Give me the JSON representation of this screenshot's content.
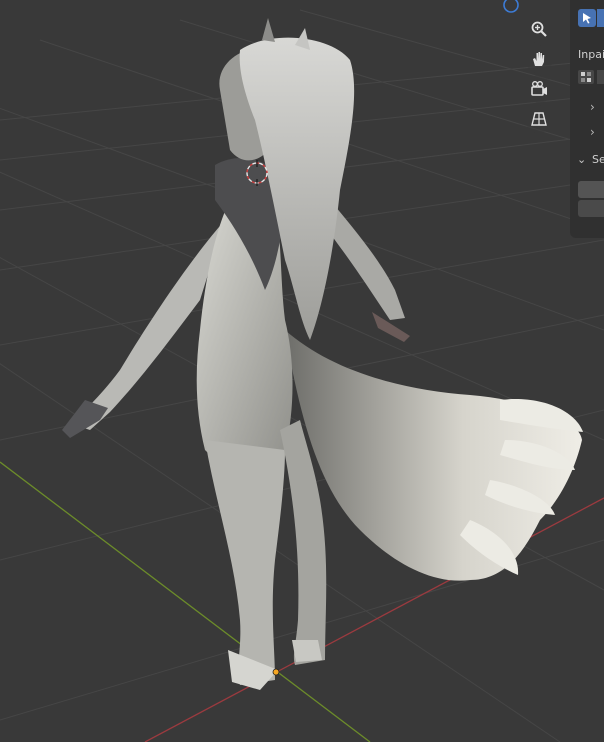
{
  "viewport": {
    "background": "#393939",
    "x_axis_color": "#9b3a3f",
    "y_axis_color": "#6c8c2a",
    "grid_color": "#464646",
    "object_name": "furry-character-model"
  },
  "navigation_gizmo": {
    "zoom_icon": "zoom-icon",
    "pan_icon": "hand-icon",
    "camera_icon": "camera-icon",
    "perspective_icon": "grid-perspective-icon"
  },
  "sidebar": {
    "tool_icon": "cursor-select-icon",
    "inpaint_label": "Inpai",
    "section_label": "Se",
    "accent": "#4772b3"
  }
}
